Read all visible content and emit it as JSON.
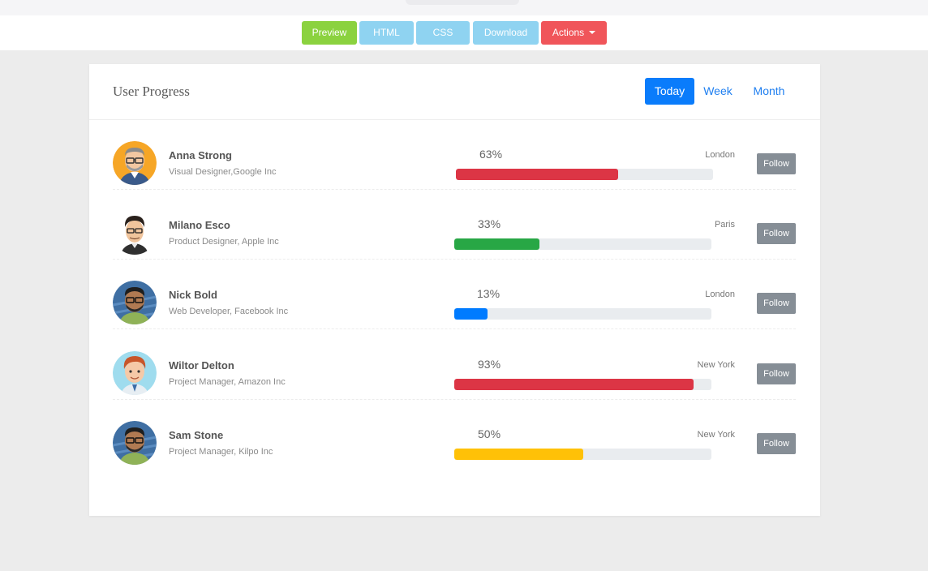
{
  "toolbar": {
    "preview": "Preview",
    "html": "HTML",
    "css": "CSS",
    "download": "Download",
    "actions": "Actions"
  },
  "card": {
    "title": "User Progress",
    "tabs": [
      "Today",
      "Week",
      "Month"
    ],
    "active_tab": "Today"
  },
  "users": [
    {
      "name": "Anna Strong",
      "role": "Visual Designer,Google Inc",
      "percent": "63%",
      "progress": 0.63,
      "city": "London",
      "bar_color": "#dc3545",
      "follow": "Follow",
      "avatar": "man-glasses-avatar"
    },
    {
      "name": "Milano Esco",
      "role": "Product Designer, Apple Inc",
      "percent": "33%",
      "progress": 0.33,
      "city": "Paris",
      "bar_color": "#28a745",
      "follow": "Follow",
      "avatar": "man-dark-hair-avatar"
    },
    {
      "name": "Nick Bold",
      "role": "Web Developer, Facebook Inc",
      "percent": "13%",
      "progress": 0.13,
      "city": "London",
      "bar_color": "#007bff",
      "follow": "Follow",
      "avatar": "man-glasses-green-shirt-avatar"
    },
    {
      "name": "Wiltor Delton",
      "role": "Project Manager, Amazon Inc",
      "percent": "93%",
      "progress": 0.93,
      "city": "New York",
      "bar_color": "#dc3545",
      "follow": "Follow",
      "avatar": "man-red-hair-avatar"
    },
    {
      "name": "Sam Stone",
      "role": "Project Manager, Kilpo Inc",
      "percent": "50%",
      "progress": 0.5,
      "city": "New York",
      "bar_color": "#ffc107",
      "follow": "Follow",
      "avatar": "man-glasses-green-shirt-avatar"
    }
  ],
  "colors": {
    "accent": "#0a7cfb",
    "preview": "#8bd23f",
    "toolbar_light": "#8fd3f1",
    "actions": "#f0555a",
    "follow": "#868e96"
  }
}
